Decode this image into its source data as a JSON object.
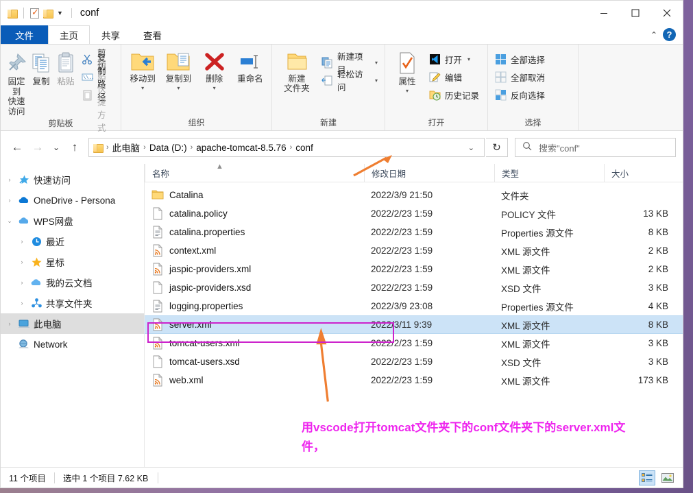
{
  "window": {
    "title": "conf",
    "quick_access": [
      "folder-icon",
      "properties-icon",
      "folder-icon",
      "dropdown-caret"
    ],
    "controls": {
      "minimize": "minimize-icon",
      "maximize": "maximize-icon",
      "close": "close-icon"
    }
  },
  "tabs": [
    {
      "label": "文件",
      "kind": "file"
    },
    {
      "label": "主页",
      "kind": "active"
    },
    {
      "label": "共享",
      "kind": "normal"
    },
    {
      "label": "查看",
      "kind": "normal"
    }
  ],
  "tabbar_right": {
    "collapse": "chevron-up-icon",
    "help": "?"
  },
  "ribbon": {
    "groups": [
      {
        "title": "剪贴板",
        "big": [
          {
            "label1": "固定到",
            "label2": "快速访问",
            "icon": "pin-icon",
            "dim": false
          },
          {
            "label1": "复制",
            "label2": "",
            "icon": "copy-icon",
            "dim": false
          },
          {
            "label1": "粘贴",
            "label2": "",
            "icon": "paste-icon",
            "dim": true
          }
        ],
        "small": [
          {
            "label": "剪切",
            "icon": "scissors-icon",
            "dim": false
          },
          {
            "label": "复制路径",
            "icon": "copy-path-icon",
            "dim": false
          },
          {
            "label": "粘贴快捷方式",
            "icon": "paste-shortcut-icon",
            "dim": true
          }
        ]
      },
      {
        "title": "组织",
        "big": [
          {
            "label1": "移动到",
            "label2": "",
            "icon": "move-to-icon",
            "caret": true
          },
          {
            "label1": "复制到",
            "label2": "",
            "icon": "copy-to-icon",
            "caret": true
          },
          {
            "label1": "删除",
            "label2": "",
            "icon": "delete-icon",
            "caret": true
          },
          {
            "label1": "重命名",
            "label2": "",
            "icon": "rename-icon",
            "caret": false
          }
        ],
        "small": []
      },
      {
        "title": "新建",
        "big": [
          {
            "label1": "新建",
            "label2": "文件夹",
            "icon": "new-folder-icon",
            "caret": false
          }
        ],
        "small": [
          {
            "label": "新建项目",
            "icon": "new-item-icon",
            "caret": true
          },
          {
            "label": "轻松访问",
            "icon": "easy-access-icon",
            "caret": true
          }
        ]
      },
      {
        "title": "打开",
        "big": [
          {
            "label1": "属性",
            "label2": "",
            "icon": "properties-icon",
            "caret": true
          }
        ],
        "small": [
          {
            "label": "打开",
            "icon": "vscode-icon",
            "caret": true
          },
          {
            "label": "编辑",
            "icon": "edit-icon",
            "caret": false
          },
          {
            "label": "历史记录",
            "icon": "history-icon",
            "caret": false
          }
        ]
      },
      {
        "title": "选择",
        "big": [],
        "small": [
          {
            "label": "全部选择",
            "icon": "select-all-icon",
            "caret": false
          },
          {
            "label": "全部取消",
            "icon": "select-none-icon",
            "caret": false
          },
          {
            "label": "反向选择",
            "icon": "invert-selection-icon",
            "caret": false
          }
        ]
      }
    ]
  },
  "address": {
    "back": "back-arrow-icon",
    "forward": "forward-arrow-icon",
    "recent": "chevron-down-icon",
    "up": "up-arrow-icon",
    "crumbs": [
      "此电脑",
      "Data (D:)",
      "apache-tomcat-8.5.76",
      "conf"
    ],
    "dropdown": "chevron-down-icon",
    "refresh": "refresh-icon"
  },
  "search": {
    "placeholder": "搜索\"conf\"",
    "icon": "search-icon"
  },
  "sidebar": {
    "items": [
      {
        "label": "快速访问",
        "icon": "star-pin-icon",
        "indent": false,
        "chev": "collapsed",
        "selected": false
      },
      {
        "label": "OneDrive - Persona",
        "icon": "onedrive-icon",
        "indent": false,
        "chev": "collapsed",
        "selected": false
      },
      {
        "label": "WPS网盘",
        "icon": "wps-cloud-icon",
        "indent": false,
        "chev": "expanded",
        "selected": false
      },
      {
        "label": "最近",
        "icon": "recent-clock-icon",
        "indent": true,
        "chev": "collapsed",
        "selected": false
      },
      {
        "label": "星标",
        "icon": "star-icon",
        "indent": true,
        "chev": "collapsed",
        "selected": false
      },
      {
        "label": "我的云文档",
        "icon": "cloud-doc-icon",
        "indent": true,
        "chev": "collapsed",
        "selected": false
      },
      {
        "label": "共享文件夹",
        "icon": "shared-folder-icon",
        "indent": true,
        "chev": "collapsed",
        "selected": false
      },
      {
        "label": "此电脑",
        "icon": "this-pc-icon",
        "indent": false,
        "chev": "collapsed",
        "selected": true
      },
      {
        "label": "Network",
        "icon": "network-icon",
        "indent": false,
        "chev": "none",
        "selected": false
      }
    ]
  },
  "filelist": {
    "columns": [
      "名称",
      "修改日期",
      "类型",
      "大小"
    ],
    "sort_indicator": "▲",
    "rows": [
      {
        "name": "Catalina",
        "date": "2022/3/9 21:50",
        "type": "文件夹",
        "size": "",
        "icon": "folder-icon",
        "selected": false
      },
      {
        "name": "catalina.policy",
        "date": "2022/2/23 1:59",
        "type": "POLICY 文件",
        "size": "13 KB",
        "icon": "generic-file-icon",
        "selected": false
      },
      {
        "name": "catalina.properties",
        "date": "2022/2/23 1:59",
        "type": "Properties 源文件",
        "size": "8 KB",
        "icon": "text-file-icon",
        "selected": false
      },
      {
        "name": "context.xml",
        "date": "2022/2/23 1:59",
        "type": "XML 源文件",
        "size": "2 KB",
        "icon": "xml-file-icon",
        "selected": false
      },
      {
        "name": "jaspic-providers.xml",
        "date": "2022/2/23 1:59",
        "type": "XML 源文件",
        "size": "2 KB",
        "icon": "xml-file-icon",
        "selected": false
      },
      {
        "name": "jaspic-providers.xsd",
        "date": "2022/2/23 1:59",
        "type": "XSD 文件",
        "size": "3 KB",
        "icon": "generic-file-icon",
        "selected": false
      },
      {
        "name": "logging.properties",
        "date": "2022/3/9 23:08",
        "type": "Properties 源文件",
        "size": "4 KB",
        "icon": "text-file-icon",
        "selected": false
      },
      {
        "name": "server.xml",
        "date": "2022/3/11 9:39",
        "type": "XML 源文件",
        "size": "8 KB",
        "icon": "xml-file-icon",
        "selected": true
      },
      {
        "name": "tomcat-users.xml",
        "date": "2022/2/23 1:59",
        "type": "XML 源文件",
        "size": "3 KB",
        "icon": "xml-file-icon",
        "selected": false
      },
      {
        "name": "tomcat-users.xsd",
        "date": "2022/2/23 1:59",
        "type": "XSD 文件",
        "size": "3 KB",
        "icon": "generic-file-icon",
        "selected": false
      },
      {
        "name": "web.xml",
        "date": "2022/2/23 1:59",
        "type": "XML 源文件",
        "size": "173 KB",
        "icon": "xml-file-icon",
        "selected": false
      }
    ]
  },
  "statusbar": {
    "count": "11 个项目",
    "selection": "选中 1 个项目  7.62 KB",
    "views": [
      {
        "icon": "details-view-icon",
        "active": true
      },
      {
        "icon": "large-icons-view-icon",
        "active": false
      }
    ]
  },
  "annotations": {
    "note_line1": "用vscode打开tomcat文件夹下的conf文件夹下的server.xml文",
    "note_line2": "件，",
    "note_color": "#ee25ee",
    "arrow_color": "#ef7e31",
    "rect_color": "#cc22cc"
  }
}
